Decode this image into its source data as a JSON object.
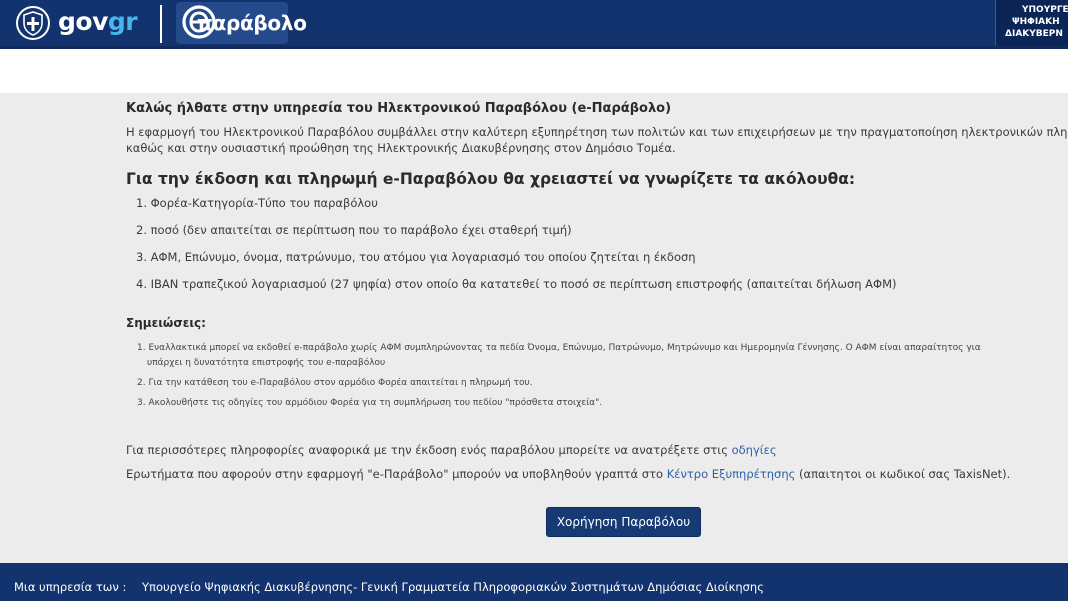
{
  "header": {
    "brand_gov": "gov",
    "brand_gr": "gr",
    "service_logo_text": "παράβολο",
    "ministry_lines": [
      "ΥΠΟΥΡΓΕ",
      "ΨΗΦΙΑΚΗ",
      "ΔΙΑΚΥΒΕΡΝ"
    ]
  },
  "main": {
    "welcome_title": "Καλώς ήλθατε στην υπηρεσία του Ηλεκτρονικού Παραβόλου (e-Παράβολο)",
    "intro_lines": [
      "Η εφαρμογή του Ηλεκτρονικού Παραβόλου συμβάλλει στην καλύτερη εξυπηρέτηση των πολιτών και των επιχειρήσεων με την πραγματοποίηση ηλεκτρονικών πλη",
      "καθώς και στην ουσιαστική προώθηση της Ηλεκτρονικής Διακυβέρνησης στον Δημόσιο Τομέα."
    ],
    "requirements_heading": "Για την έκδοση και πληρωμή e-Παραβόλου θα χρειαστεί να γνωρίζετε τα ακόλουθα:",
    "requirements": [
      "1. Φορέα-Κατηγορία-Τύπο του παραβόλου",
      "2. ποσό (δεν απαιτείται σε περίπτωση που το παράβολο έχει σταθερή τιμή)",
      "3. ΑΦΜ, Επώνυμο, όνομα, πατρώνυμο, του ατόμου για λογαριασμό του οποίου ζητείται η έκδοση",
      "4. IBAN τραπεζικού λογαριασμού (27 ψηφία) στον οποίο θα κατατεθεί το ποσό σε περίπτωση επιστροφής (απαιτείται δήλωση ΑΦΜ)"
    ],
    "notes_title": "Σημειώσεις:",
    "notes": [
      {
        "text": "1. Εναλλακτικά μπορεί να εκδοθεί e-παράβολο χωρίς ΑΦΜ συμπληρώνοντας τα πεδία Όνομα, Επώνυμο, Πατρώνυμο, Μητρώνυμο και Ημερομηνία Γέννησης. Ο ΑΦΜ είναι απαραίτητος για",
        "continuation": "υπάρχει η δυνατότητα επιστροφής του e-παραβόλου"
      },
      {
        "text": "2. Για την κατάθεση του e-Παραβόλου στον αρμόδιο Φορέα απαιτείται η πληρωμή του.",
        "continuation": ""
      },
      {
        "text": "3. Ακολουθήστε τις οδηγίες του αρμόδιου Φορέα για τη συμπλήρωση του πεδίου \"πρόσθετα στοιχεία\".",
        "continuation": ""
      }
    ],
    "info1_text": "Για περισσότερες πληροφορίες αναφορικά με την έκδοση ενός παραβόλου μπορείτε να ανατρέξετε στις ",
    "info1_link": "οδηγίες",
    "info2_before": "Ερωτήματα που αφορούν στην εφαρμογή \"e-Παράβολο\" μπορούν να υποβληθούν γραπτά στο ",
    "info2_link": "Κέντρο Εξυπηρέτησης",
    "info2_after": " (απαιτητοι οι κωδικοί σας TaxisNet).",
    "issue_button": "Χορήγηση Παραβόλου"
  },
  "footer": {
    "label": "Μια υπηρεσία των :",
    "value": "Υπουργείο Ψηφιακής Διακυβέρνησης- Γενική Γραμματεία Πληροφοριακών Συστημάτων Δημόσιας Διοίκησης"
  },
  "colors": {
    "header_bg": "#13336e",
    "brand_accent": "#45b7ec",
    "link": "#2e5fa5",
    "button_bg": "#173a74",
    "page_bg": "#ececec"
  },
  "icons": [
    "greek-emblem-icon",
    "e-parabolo-logo-icon"
  ]
}
